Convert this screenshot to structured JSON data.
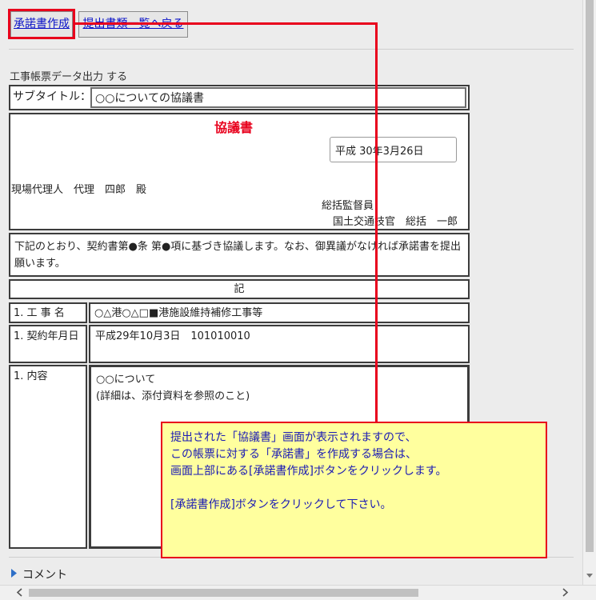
{
  "toolbar": {
    "create_consent_label": "承諾書作成",
    "back_to_list_label": "提出書類一覧へ戻る"
  },
  "report": {
    "output_label": "工事帳票データ出力 する",
    "subtitle_label": "サブタイトル：",
    "subtitle_value": "○○についての協議書"
  },
  "document": {
    "title": "協議書",
    "date": "平成 30年3月26日",
    "addressee": "現場代理人　代理　四郎　殿",
    "sender_title": "総括監督員",
    "sender_name": "国土交通技官　総括　一郎",
    "body": "下記のとおり、契約書第●条 第●項に基づき協議します。なお、御異議がなければ承諾書を提出願います。",
    "ki": "記"
  },
  "fields": [
    {
      "label": "1. 工 事 名",
      "value": "○△港○△□■港施設維持補修工事等"
    },
    {
      "label": "1. 契約年月日",
      "value": "平成29年10月3日　101010010"
    },
    {
      "label": "1. 内容",
      "value_line1": "○○について",
      "value_line2": "(詳細は、添付資料を参照のこと)"
    }
  ],
  "comment": {
    "label": "コメント"
  },
  "callout": {
    "line1": "提出された「協議書」画面が表示されますので、",
    "line2": "この帳票に対する「承諾書」を作成する場合は、",
    "line3": "画面上部にある[承諾書作成]ボタンをクリックします。",
    "line4": "[承諾書作成]ボタンをクリックして下さい。"
  },
  "colors": {
    "annotation_red": "#e8001c",
    "callout_bg": "#ffff9e",
    "callout_text": "#1a1ab4",
    "doc_title": "#e8001c"
  }
}
